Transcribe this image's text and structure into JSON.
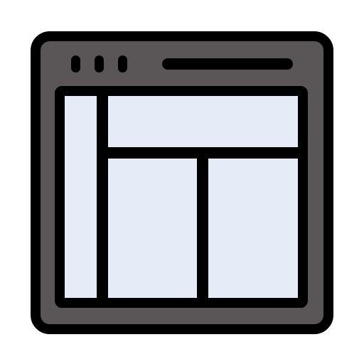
{
  "icon": {
    "name": "browser-layout-icon",
    "window_dots": 3
  },
  "colors": {
    "outline": "#000000",
    "frame": "#5a5658",
    "panel": "#e6ecf7",
    "background": "#ffffff"
  }
}
